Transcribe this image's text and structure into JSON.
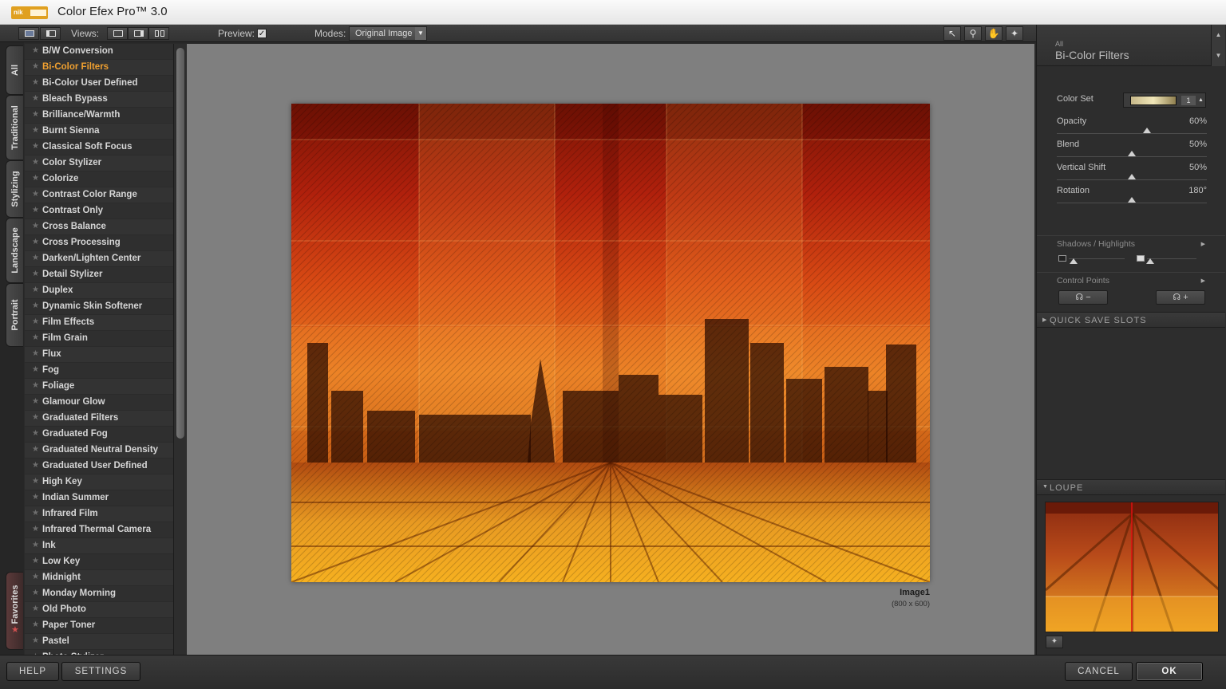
{
  "app": {
    "title": "Color Efex Pro™ 3.0",
    "logo_text": "nik"
  },
  "toolbar": {
    "views_label": "Views:",
    "preview_label": "Preview:",
    "preview_checked": "✓",
    "modes_label": "Modes:",
    "modes_value": "Original Image"
  },
  "tabs": [
    {
      "label": "All"
    },
    {
      "label": "Traditional"
    },
    {
      "label": "Stylizing"
    },
    {
      "label": "Landscape"
    },
    {
      "label": "Portrait"
    },
    {
      "label": "Favorites"
    }
  ],
  "filters": [
    "B/W Conversion",
    "Bi-Color Filters",
    "Bi-Color User Defined",
    "Bleach Bypass",
    "Brilliance/Warmth",
    "Burnt Sienna",
    "Classical Soft Focus",
    "Color Stylizer",
    "Colorize",
    "Contrast Color Range",
    "Contrast Only",
    "Cross Balance",
    "Cross Processing",
    "Darken/Lighten Center",
    "Detail Stylizer",
    "Duplex",
    "Dynamic Skin Softener",
    "Film Effects",
    "Film Grain",
    "Flux",
    "Fog",
    "Foliage",
    "Glamour Glow",
    "Graduated Filters",
    "Graduated Fog",
    "Graduated Neutral Density",
    "Graduated User Defined",
    "High Key",
    "Indian Summer",
    "Infrared Film",
    "Infrared Thermal Camera",
    "Ink",
    "Low Key",
    "Midnight",
    "Monday Morning",
    "Old Photo",
    "Paper Toner",
    "Pastel",
    "Photo Stylizer"
  ],
  "selected_filter": "Bi-Color Filters",
  "image": {
    "name": "Image1",
    "size": "(800 x 600)"
  },
  "panel": {
    "crumb": "All",
    "title": "Bi-Color Filters",
    "color_set_label": "Color Set",
    "color_set_value": "1",
    "controls": [
      {
        "label": "Opacity",
        "value": "60%",
        "level": 0.6
      },
      {
        "label": "Blend",
        "value": "50%",
        "level": 0.5
      },
      {
        "label": "Vertical Shift",
        "value": "50%",
        "level": 0.5
      },
      {
        "label": "Rotation",
        "value": "180°",
        "level": 0.5
      }
    ],
    "shadows_highlights_label": "Shadows / Highlights",
    "control_points_label": "Control Points",
    "quick_save_label": "QUICK SAVE SLOTS",
    "loupe_label": "LOUPE",
    "minus": "−",
    "plus": "+"
  },
  "buttons": {
    "help": "HELP",
    "settings": "SETTINGS",
    "cancel": "CANCEL",
    "ok": "OK"
  },
  "colors": {
    "accent": "#f0a030",
    "photo_top": "#8a1a08",
    "photo_mid": "#d8561a",
    "photo_bottom": "#f2a618"
  }
}
